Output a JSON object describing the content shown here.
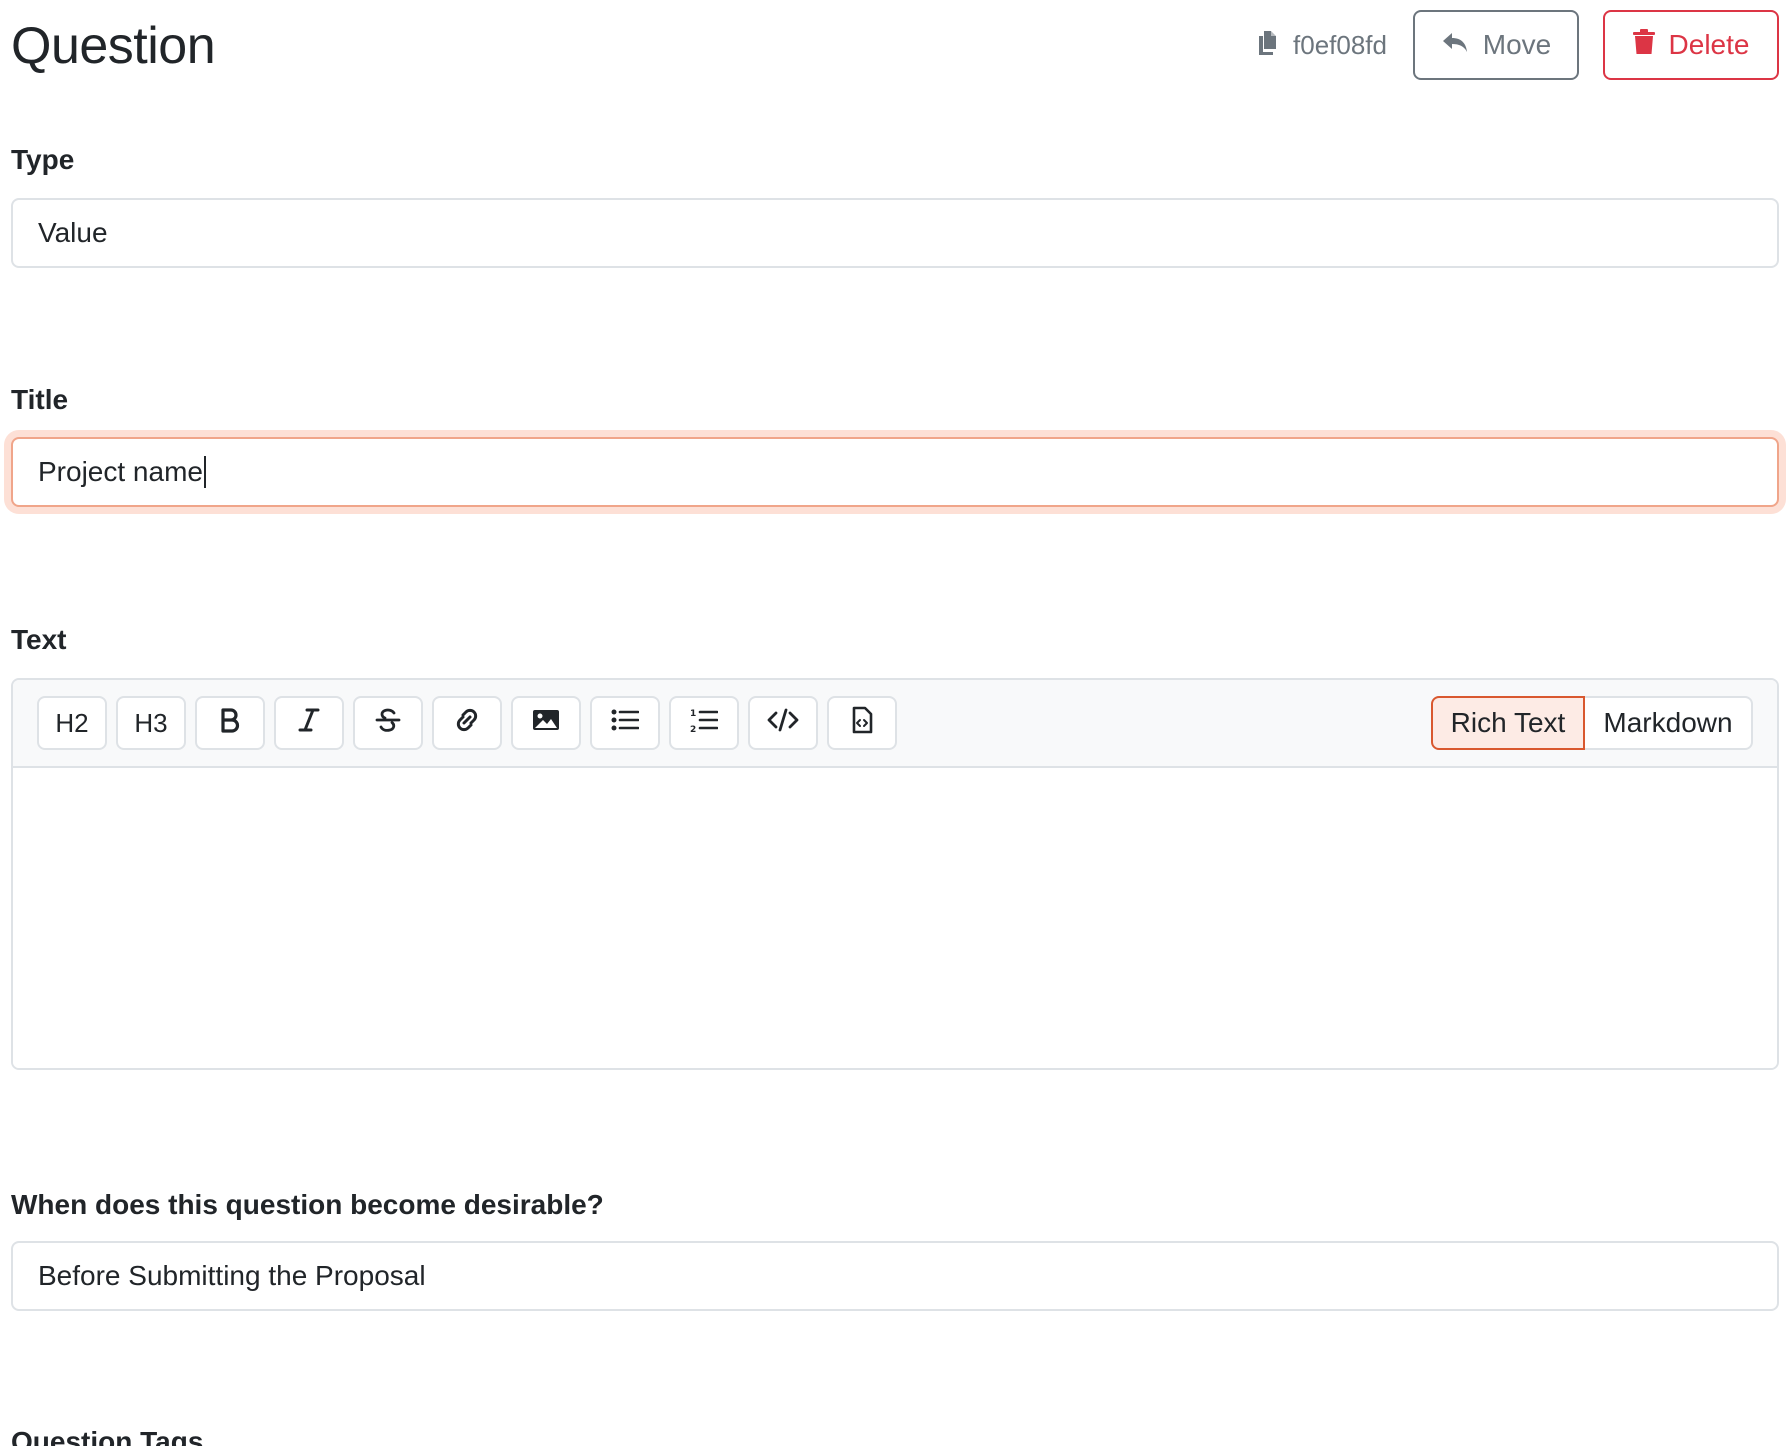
{
  "header": {
    "title": "Question",
    "uuid": "f0ef08fd",
    "move_label": "Move",
    "delete_label": "Delete"
  },
  "fields": {
    "type": {
      "label": "Type",
      "value": "Value"
    },
    "title": {
      "label": "Title",
      "value": "Project name"
    },
    "text": {
      "label": "Text",
      "value": ""
    },
    "desirable": {
      "label": "When does this question become desirable?",
      "value": "Before Submitting the Proposal"
    },
    "tags": {
      "label": "Question Tags"
    }
  },
  "editor": {
    "toolbar": {
      "h2": "H2",
      "h3": "H3"
    },
    "modes": {
      "rich": "Rich Text",
      "markdown": "Markdown"
    },
    "active_mode": "Rich Text"
  },
  "colors": {
    "danger": "#dc3545",
    "secondary": "#6c757d",
    "focus_border": "#f0a58a",
    "focus_ring": "#fde0d6",
    "active_mode_bg": "#fdebe5",
    "active_mode_border": "#d9582f"
  },
  "icons": {
    "uuid": "copy-icon",
    "move": "reply-arrow-icon",
    "delete": "trash-icon",
    "toolbar": [
      "bold-icon",
      "italic-icon",
      "strikethrough-icon",
      "link-icon",
      "image-icon",
      "bullet-list-icon",
      "ordered-list-icon",
      "code-icon",
      "code-block-icon"
    ]
  }
}
